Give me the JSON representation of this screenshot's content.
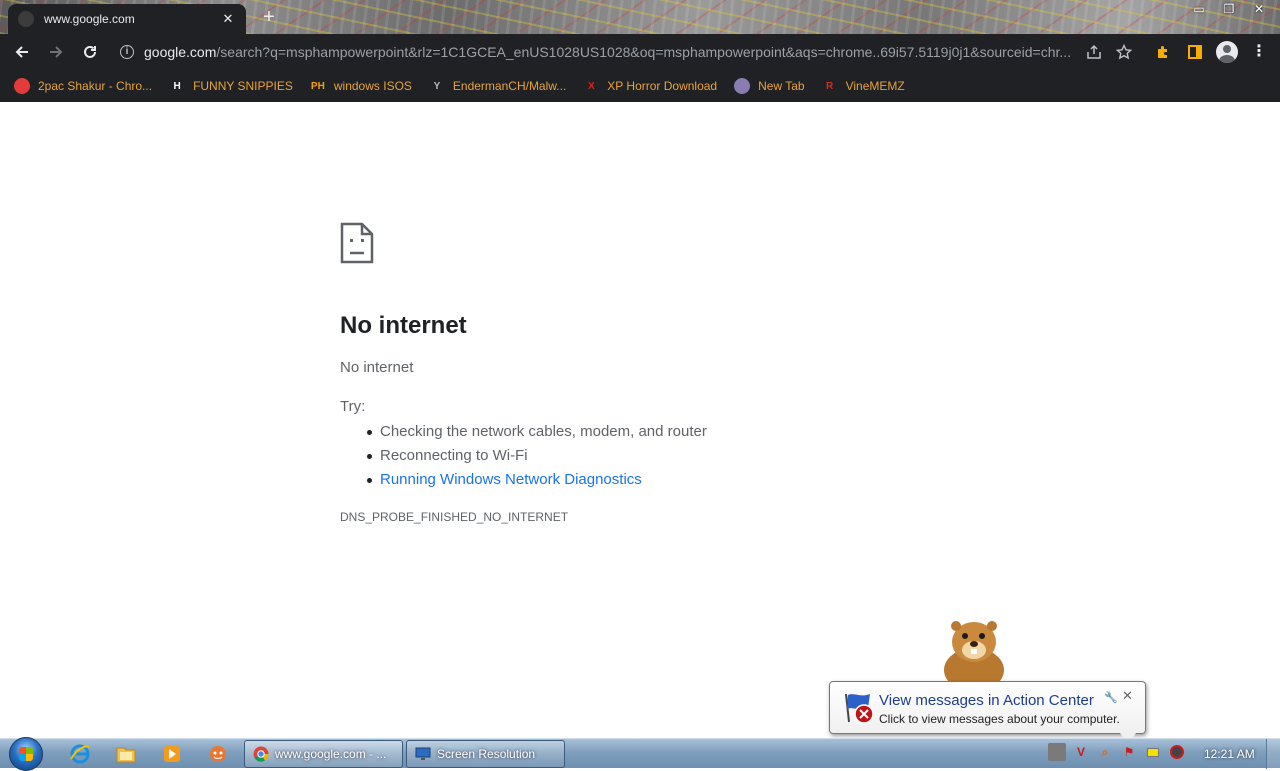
{
  "tab": {
    "title": "www.google.com",
    "close": "✕",
    "new_tab": "+"
  },
  "window_controls": {
    "minimize": "▭",
    "restore": "❐",
    "close": "✕"
  },
  "address_bar": {
    "host": "google.com",
    "rest": "/search?q=msphampowerpoint&rlz=1C1GCEA_enUS1028US1028&oq=msphampowerpoint&aqs=chrome..69i57.5119j0j1&sourceid=chr..."
  },
  "bookmarks": [
    {
      "label": "2pac Shakur - Chro...",
      "icon": "tupac-favicon",
      "icon_text": "",
      "icon_color": "#e33b3b"
    },
    {
      "label": "FUNNY SNIPPIES",
      "icon": "h-favicon",
      "icon_text": "H",
      "icon_color": "#ffffff"
    },
    {
      "label": "windows ISOS",
      "icon": "ph-favicon",
      "icon_text": "PH",
      "icon_color": "#f6a100"
    },
    {
      "label": "EndermanCH/Malw...",
      "icon": "ya-favicon",
      "icon_text": "Y",
      "icon_color": "#bbbbbb"
    },
    {
      "label": "XP Horror Download",
      "icon": "x-favicon",
      "icon_text": "X",
      "icon_color": "#e11d1d"
    },
    {
      "label": "New Tab",
      "icon": "globe-favicon",
      "icon_text": "",
      "icon_color": "#8a7bb0"
    },
    {
      "label": "VineMEMZ",
      "icon": "r-favicon",
      "icon_text": "R",
      "icon_color": "#d62d20"
    }
  ],
  "error": {
    "title": "No internet",
    "subtitle": "No internet",
    "try_label": "Try:",
    "suggestions": [
      "Checking the network cables, modem, and router",
      "Reconnecting to Wi-Fi"
    ],
    "diagnostics_link": "Running Windows Network Diagnostics",
    "code": "DNS_PROBE_FINISHED_NO_INTERNET"
  },
  "balloon": {
    "title": "View messages in Action Center",
    "text": "Click to view messages about your computer.",
    "close": "✕"
  },
  "taskbar": {
    "tasks": [
      {
        "label": "www.google.com - ...",
        "icon": "chrome-icon"
      },
      {
        "label": "Screen Resolution",
        "icon": "display-icon"
      }
    ],
    "clock": "12:21 AM"
  },
  "colors": {
    "chrome_dark": "#202124",
    "bookmark_text": "#e8a33b",
    "link": "#1a73e8",
    "taskbar": "#7f9fbd"
  }
}
